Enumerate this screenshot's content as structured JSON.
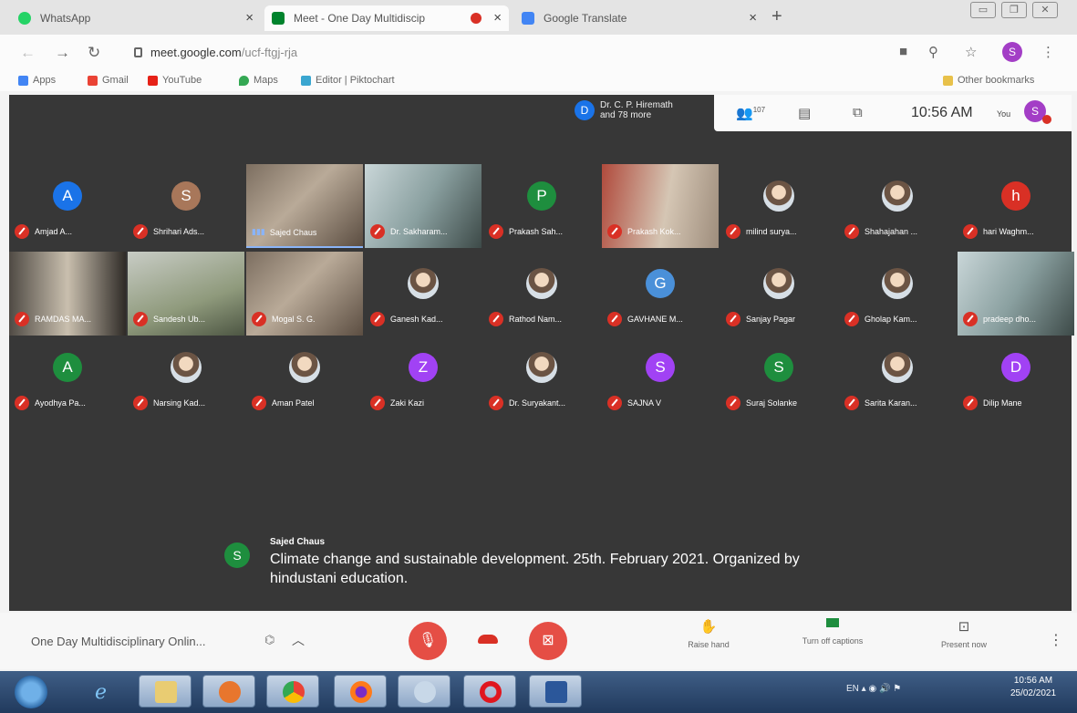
{
  "browser": {
    "tabs": [
      {
        "title": "WhatsApp",
        "color": "#25d366",
        "active": false
      },
      {
        "title": "Meet - One Day Multidiscip",
        "color": "#00832d",
        "active": true
      },
      {
        "title": "Google Translate",
        "color": "#4285f4",
        "active": false
      }
    ],
    "url_host": "meet.google.com",
    "url_path": "/ucf-ftgj-rja",
    "profile_initial": "S",
    "bookmarks": [
      "Apps",
      "Gmail",
      "YouTube",
      "Maps",
      "Editor | Piktochart"
    ],
    "other_bookmarks": "Other bookmarks"
  },
  "meet": {
    "presenter_label_line1": "Dr. C. P. Hiremath",
    "presenter_label_line2": "and 78 more",
    "presenter_initial": "D",
    "participant_count": "107",
    "time": "10:56 AM",
    "you_label": "You",
    "self_initial": "S",
    "participants": [
      {
        "name": "Amjad A...",
        "kind": "avatar",
        "initial": "A",
        "color": "#1a73e8"
      },
      {
        "name": "Shrihari Ads...",
        "kind": "avatar",
        "initial": "S",
        "color": "#a8775a"
      },
      {
        "name": "Sajed Chaus",
        "kind": "video",
        "speaking": true
      },
      {
        "name": "Dr. Sakharam...",
        "kind": "video"
      },
      {
        "name": "Prakash Sah...",
        "kind": "avatar",
        "initial": "P",
        "color": "#1e8e3e"
      },
      {
        "name": "Prakash Kok...",
        "kind": "video"
      },
      {
        "name": "milind surya...",
        "kind": "photo"
      },
      {
        "name": "Shahajahan ...",
        "kind": "photo"
      },
      {
        "name": "hari Waghm...",
        "kind": "avatar",
        "initial": "h",
        "color": "#d93025"
      },
      {
        "name": "RAMDAS MA...",
        "kind": "video"
      },
      {
        "name": "Sandesh Ub...",
        "kind": "video"
      },
      {
        "name": "Mogal S. G.",
        "kind": "video"
      },
      {
        "name": "Ganesh Kad...",
        "kind": "photo"
      },
      {
        "name": "Rathod Nam...",
        "kind": "photo"
      },
      {
        "name": "GAVHANE M...",
        "kind": "avatar",
        "initial": "G",
        "color": "#4a90d9"
      },
      {
        "name": "Sanjay Pagar",
        "kind": "photo"
      },
      {
        "name": "Gholap Kam...",
        "kind": "photo"
      },
      {
        "name": "pradeep dho...",
        "kind": "video"
      },
      {
        "name": "Ayodhya Pa...",
        "kind": "avatar",
        "initial": "A",
        "color": "#1e8e3e"
      },
      {
        "name": "Narsing Kad...",
        "kind": "photo"
      },
      {
        "name": "Aman Patel",
        "kind": "photo"
      },
      {
        "name": "Zaki Kazi",
        "kind": "avatar",
        "initial": "Z",
        "color": "#a142f4"
      },
      {
        "name": "Dr. Suryakant...",
        "kind": "photo"
      },
      {
        "name": "SAJNA V",
        "kind": "avatar",
        "initial": "S",
        "color": "#a142f4"
      },
      {
        "name": "Suraj Solanke",
        "kind": "avatar",
        "initial": "S",
        "color": "#1e8e3e"
      },
      {
        "name": "Sarita Karan...",
        "kind": "photo"
      },
      {
        "name": "Dilip Mane",
        "kind": "avatar",
        "initial": "D",
        "color": "#a142f4"
      }
    ],
    "caption": {
      "speaker_initial": "S",
      "speaker": "Sajed Chaus",
      "text": "Climate change and sustainable development. 25th. February 2021. Organized by hindustani education."
    },
    "meeting_name": "One Day Multidisciplinary Onlin...",
    "controls": {
      "raise_hand": "Raise hand",
      "captions": "Turn off captions",
      "present": "Present now"
    }
  },
  "taskbar": {
    "lang": "EN",
    "time": "10:56 AM",
    "date": "25/02/2021"
  }
}
